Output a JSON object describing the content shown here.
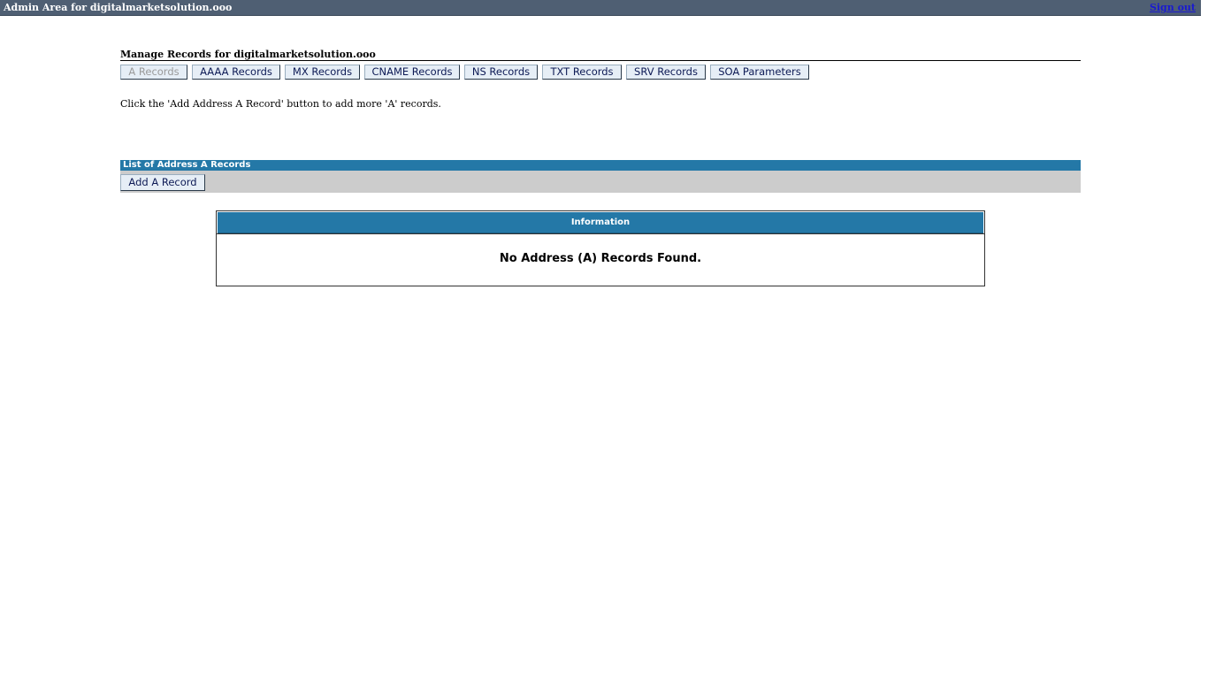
{
  "header": {
    "title": "Admin Area for digitalmarketsolution.ooo",
    "signout_label": "Sign out"
  },
  "page": {
    "title": "Manage Records for digitalmarketsolution.ooo",
    "hint": "Click the 'Add Address A Record' button to add more 'A' records."
  },
  "tabs": [
    {
      "label": "A Records",
      "state": "disabled"
    },
    {
      "label": "AAAA Records"
    },
    {
      "label": "MX Records"
    },
    {
      "label": "CNAME Records"
    },
    {
      "label": "NS Records"
    },
    {
      "label": "TXT Records"
    },
    {
      "label": "SRV Records"
    },
    {
      "label": "SOA Parameters"
    }
  ],
  "records_section": {
    "title": "List of Address A Records",
    "add_button_label": "Add A Record"
  },
  "info": {
    "heading": "Information",
    "message": "No Address (A) Records Found."
  },
  "colors": {
    "topbar": "#4f5f73",
    "section_header": "#2478a7",
    "toolbar": "#cccccc",
    "tab_background": "#e6eef6",
    "tab_text": "#0d1a55",
    "link": "#1a1ad0"
  }
}
